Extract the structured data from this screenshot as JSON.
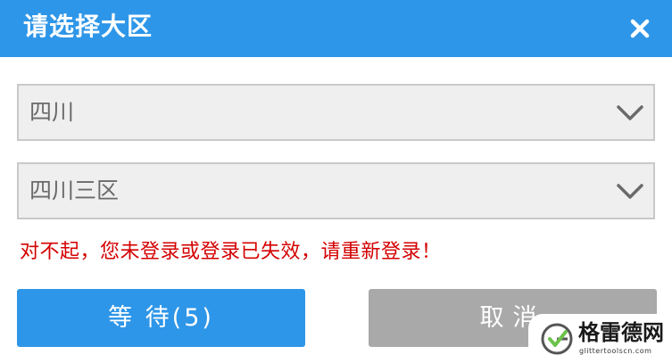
{
  "dialog": {
    "title": "请选择大区",
    "close_icon": "close-icon"
  },
  "selects": [
    {
      "value": "四川",
      "icon": "chevron-down-icon"
    },
    {
      "value": "四川三区",
      "icon": "chevron-down-icon"
    }
  ],
  "error_message": "对不起，您未登录或登录已失效，请重新登录！",
  "buttons": {
    "wait_label": "等 待(5)",
    "cancel_label": "取消"
  },
  "watermark": {
    "name": "格雷德网",
    "url": "glittertoolscn.com",
    "logo_icon": "g-logo-icon"
  },
  "colors": {
    "accent": "#2e96e8",
    "cancel_gray": "#a9a9a9",
    "error_red": "#d40000",
    "select_bg": "#efefef"
  }
}
